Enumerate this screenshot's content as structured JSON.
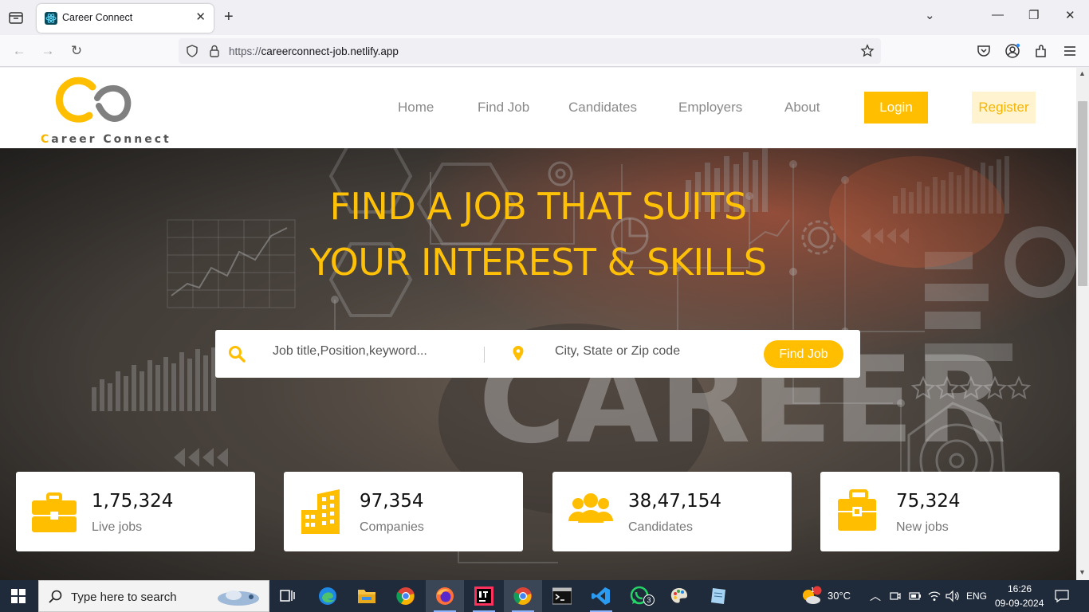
{
  "browser": {
    "tab_title": "Career Connect",
    "url_prefix": "https://",
    "url_host": "careerconnect-job.netlify.app"
  },
  "site": {
    "logo_first_letter": "C",
    "logo_rest": "areer Connect",
    "menu": [
      "Home",
      "Find Job",
      "Candidates",
      "Employers",
      "About"
    ],
    "login_label": "Login",
    "register_label": "Register"
  },
  "hero": {
    "title_line1": "FIND A JOB THAT SUITS",
    "title_line2": "YOUR INTEREST & SKILLS",
    "search_placeholder": "Job title,Position,keyword...",
    "location_placeholder": "City, State or Zip code",
    "find_button": "Find Job",
    "background_word": "CAREER"
  },
  "stats": [
    {
      "value": "1,75,324",
      "label": "Live jobs",
      "icon": "briefcase-icon"
    },
    {
      "value": "97,354",
      "label": "Companies",
      "icon": "buildings-icon"
    },
    {
      "value": "38,47,154",
      "label": "Candidates",
      "icon": "people-icon"
    },
    {
      "value": "75,324",
      "label": "New jobs",
      "icon": "briefcase-plus-icon"
    }
  ],
  "taskbar": {
    "search_placeholder": "Type here to search",
    "temperature": "30°C",
    "language": "ENG",
    "time": "16:26",
    "date": "09-09-2024",
    "whatsapp_badge": "3",
    "weather_badge": "1"
  },
  "colors": {
    "accent": "#ffbe00",
    "accent_light": "#fff4cf",
    "hero_title": "#ffc107"
  }
}
